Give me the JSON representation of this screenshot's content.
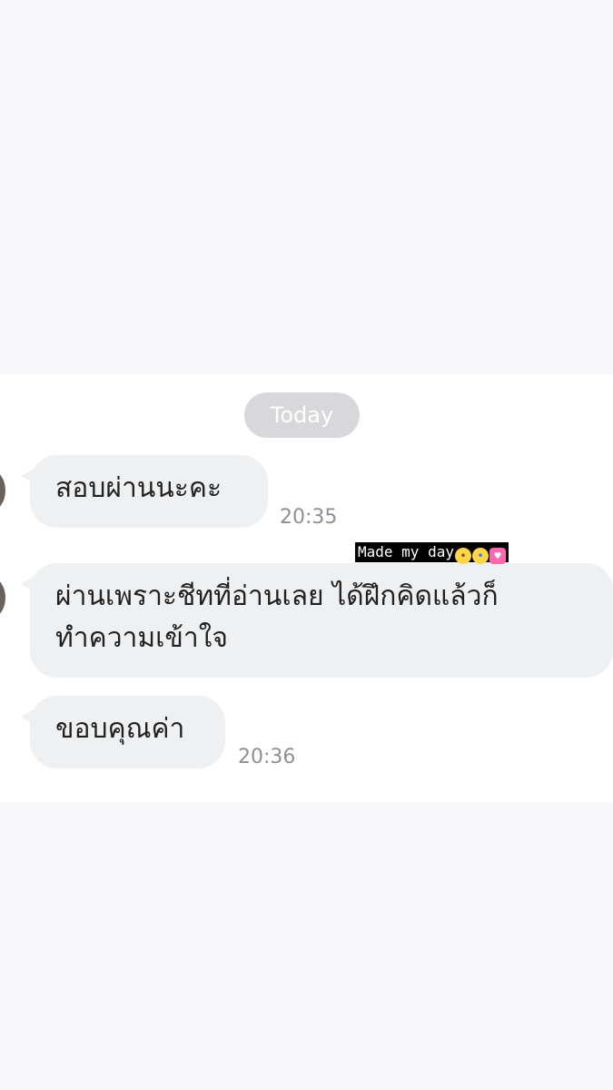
{
  "chat": {
    "date_label": "Today",
    "messages": [
      {
        "text": "สอบผ่านนะคะ",
        "time": "20:35"
      },
      {
        "lines": [
          "ผ่านเพราะชีทที่อ่านเลย ได้ฝึกคิดแล้วก็",
          "ทำความเข้าใจ"
        ]
      },
      {
        "text": "ขอบคุณค่า",
        "time": "20:36"
      }
    ],
    "caption": {
      "text": "Made my day",
      "emojis": [
        "pleading-face-icon",
        "loudly-crying-face-icon",
        "sparkling-heart-icon"
      ]
    }
  },
  "colors": {
    "page_background": "#f8f8fa",
    "chat_background": "#ffffff",
    "bubble": "#eff0f2",
    "date_pill": "#d8d8da",
    "timestamp": "#8e9094",
    "caption_background": "#000000"
  }
}
